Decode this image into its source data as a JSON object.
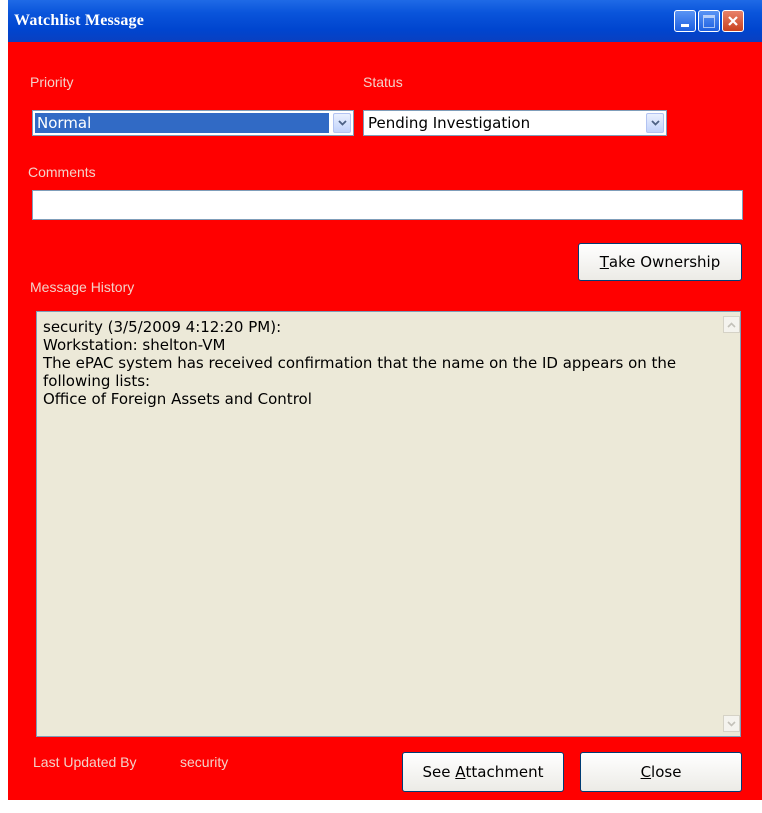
{
  "window": {
    "title": "Watchlist Message"
  },
  "priority": {
    "label": "Priority",
    "value": "Normal"
  },
  "status": {
    "label": "Status",
    "value": "Pending Investigation"
  },
  "comments": {
    "label": "Comments",
    "value": ""
  },
  "take_ownership": {
    "pre": "",
    "accel": "T",
    "post": "ake Ownership"
  },
  "history": {
    "label": "Message History",
    "lines": [
      "security (3/5/2009 4:12:20 PM):",
      "Workstation: shelton-VM",
      "The ePAC system has received confirmation that the name on the ID appears on the following lists:",
      "Office of Foreign Assets and Control"
    ]
  },
  "footer": {
    "last_updated_label": "Last Updated By",
    "last_updated_value": "security",
    "see_attachment": {
      "pre": "See ",
      "accel": "A",
      "post": "ttachment"
    },
    "close": {
      "pre": "",
      "accel": "C",
      "post": "lose"
    }
  },
  "icons": {
    "minimize": "minimize-icon",
    "maximize": "maximize-icon",
    "close": "close-x-icon",
    "dropdown": "chevron-down-icon"
  },
  "colors": {
    "background": "#ff0000",
    "titlebar": "#0a55db",
    "label": "#f3d2c9",
    "selected": "#316ac5"
  }
}
